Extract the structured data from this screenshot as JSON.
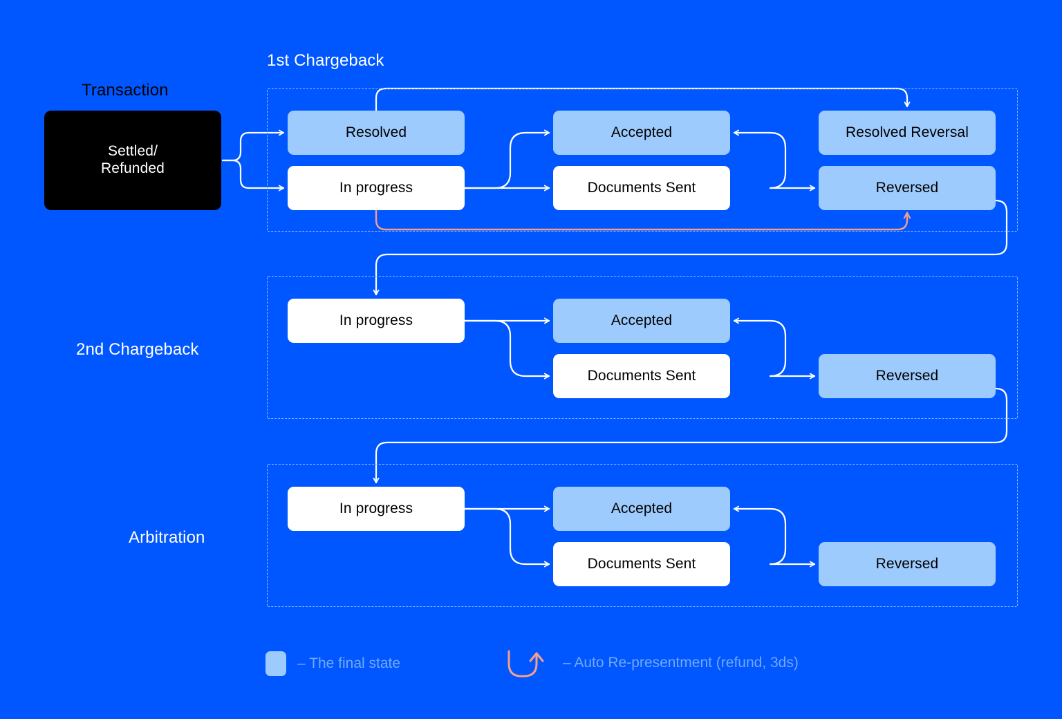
{
  "diagram": {
    "title_section": "1st Chargeback",
    "colors": {
      "background": "#0057ff",
      "final_state": "#9ecbfd",
      "in_progress": "#ffffff",
      "origin": "#000000",
      "connector": "#ffffff",
      "auto_representment": "#f79e8c",
      "frame_dashed": "#8fc0ff",
      "legend_text": "#73a8fb"
    },
    "captions": {
      "transaction": "Transaction",
      "first_chargeback": "1st Chargeback",
      "second_chargeback": "2nd Chargeback",
      "arbitration": "Arbitration"
    },
    "nodes": {
      "origin": "Settled/\nRefunded",
      "origin_line1": "Settled/",
      "origin_line2": "Refunded",
      "cb1_resolved": "Resolved",
      "cb1_in_progress": "In progress",
      "cb1_accepted": "Accepted",
      "cb1_documents_sent": "Documents Sent",
      "cb1_resolved_reversal": "Resolved Reversal",
      "cb1_reversed": "Reversed",
      "cb2_in_progress": "In progress",
      "cb2_accepted": "Accepted",
      "cb2_documents_sent": "Documents Sent",
      "cb2_reversed": "Reversed",
      "arb_in_progress": "In progress",
      "arb_accepted": "Accepted",
      "arb_documents_sent": "Documents Sent",
      "arb_reversed": "Reversed"
    },
    "legend": {
      "final_state_label": "– The final state",
      "auto_representment_label": "– Auto Re-presentment (refund, 3ds)"
    }
  },
  "chart_data": {
    "type": "diagram",
    "title": "Chargeback lifecycle state diagram",
    "groups": [
      {
        "name": "1st Chargeback",
        "states": [
          {
            "label": "Resolved",
            "final": true
          },
          {
            "label": "In progress",
            "final": false
          },
          {
            "label": "Accepted",
            "final": true
          },
          {
            "label": "Documents Sent",
            "final": false
          },
          {
            "label": "Resolved Reversal",
            "final": true
          },
          {
            "label": "Reversed",
            "final": true
          }
        ]
      },
      {
        "name": "2nd Chargeback",
        "states": [
          {
            "label": "In progress",
            "final": false
          },
          {
            "label": "Accepted",
            "final": true
          },
          {
            "label": "Documents Sent",
            "final": false
          },
          {
            "label": "Reversed",
            "final": true
          }
        ]
      },
      {
        "name": "Arbitration",
        "states": [
          {
            "label": "In progress",
            "final": false
          },
          {
            "label": "Accepted",
            "final": true
          },
          {
            "label": "Documents Sent",
            "final": false
          },
          {
            "label": "Reversed",
            "final": true
          }
        ]
      }
    ],
    "edges": [
      {
        "from": "Settled/Refunded",
        "to": "Resolved",
        "group": "1st Chargeback",
        "style": "solid"
      },
      {
        "from": "Settled/Refunded",
        "to": "In progress",
        "group": "1st Chargeback",
        "style": "solid"
      },
      {
        "from": "Resolved",
        "to": "Resolved Reversal",
        "group": "1st Chargeback",
        "style": "solid"
      },
      {
        "from": "In progress",
        "to": "Accepted",
        "group": "1st Chargeback",
        "style": "solid"
      },
      {
        "from": "In progress",
        "to": "Documents Sent",
        "group": "1st Chargeback",
        "style": "solid"
      },
      {
        "from": "Documents Sent",
        "to": "Accepted",
        "group": "1st Chargeback",
        "style": "solid"
      },
      {
        "from": "Documents Sent",
        "to": "Reversed",
        "group": "1st Chargeback",
        "style": "solid"
      },
      {
        "from": "In progress",
        "to": "Reversed",
        "group": "1st Chargeback",
        "style": "auto-representment"
      },
      {
        "from": "Reversed (1st)",
        "to": "In progress (2nd)",
        "group": "2nd Chargeback",
        "style": "solid"
      },
      {
        "from": "In progress",
        "to": "Accepted",
        "group": "2nd Chargeback",
        "style": "solid"
      },
      {
        "from": "In progress",
        "to": "Documents Sent",
        "group": "2nd Chargeback",
        "style": "solid"
      },
      {
        "from": "Documents Sent",
        "to": "Accepted",
        "group": "2nd Chargeback",
        "style": "solid"
      },
      {
        "from": "Documents Sent",
        "to": "Reversed",
        "group": "2nd Chargeback",
        "style": "solid"
      },
      {
        "from": "Reversed (2nd)",
        "to": "In progress (Arbitration)",
        "group": "Arbitration",
        "style": "solid"
      },
      {
        "from": "In progress",
        "to": "Accepted",
        "group": "Arbitration",
        "style": "solid"
      },
      {
        "from": "In progress",
        "to": "Documents Sent",
        "group": "Arbitration",
        "style": "solid"
      },
      {
        "from": "Documents Sent",
        "to": "Accepted",
        "group": "Arbitration",
        "style": "solid"
      },
      {
        "from": "Documents Sent",
        "to": "Reversed",
        "group": "Arbitration",
        "style": "solid"
      }
    ],
    "legend": [
      {
        "swatch": "#9ecbfd",
        "label": "– The final state"
      },
      {
        "swatch": "#f79e8c",
        "label": "– Auto Re-presentment (refund, 3ds)"
      }
    ]
  }
}
